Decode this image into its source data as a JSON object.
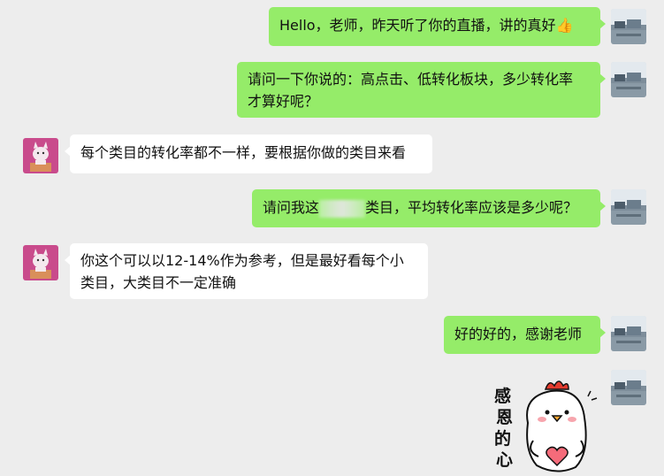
{
  "messages": [
    {
      "side": "right",
      "text": "Hello，老师，昨天听了你的直播，讲的真好",
      "emoji": "👍"
    },
    {
      "side": "right",
      "lines": [
        "请问一下你说的：高点击、低转化板块，多少转化率",
        "才算好呢？"
      ]
    },
    {
      "side": "left",
      "text": "每个类目的转化率都不一样，要根据你做的类目来看"
    },
    {
      "side": "right",
      "text_before": "请问我这",
      "text_after": "类目，平均转化率应该是多少呢？"
    },
    {
      "side": "left",
      "lines": [
        "你这个可以以12-14%作为参考，但是最好看每个小",
        "类目，大类目不一定准确"
      ]
    },
    {
      "side": "right",
      "text": "好的好的，感谢老师"
    },
    {
      "side": "right",
      "sticker": "chicken-thanks-sticker",
      "sticker_text": "感恩的心"
    }
  ]
}
